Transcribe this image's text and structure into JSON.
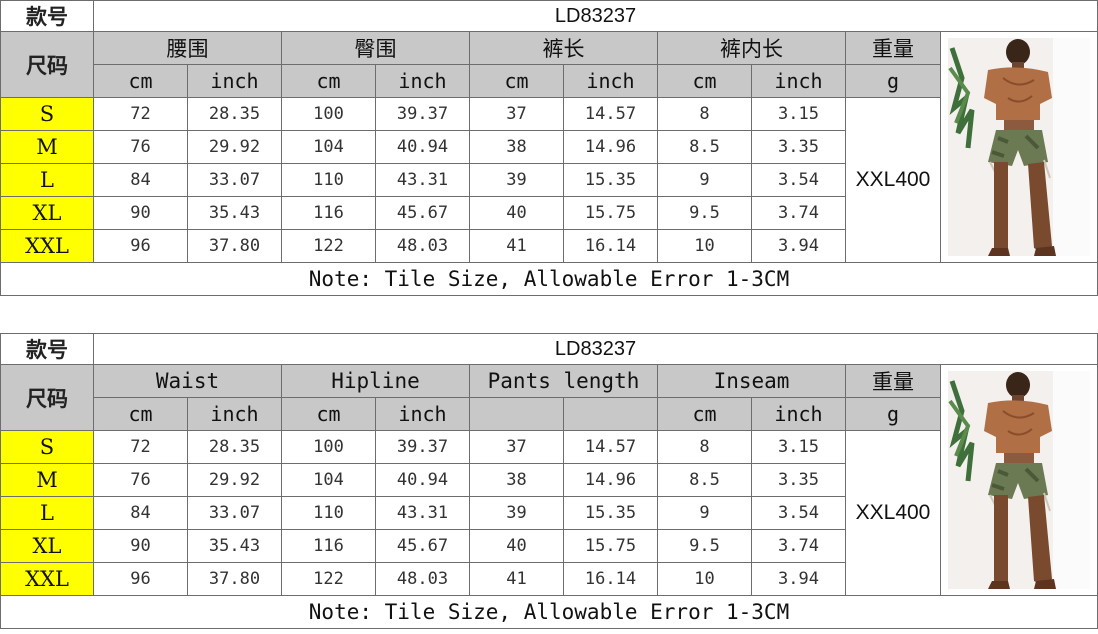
{
  "tables": [
    {
      "style_label": "款号",
      "style_code": "LD83237",
      "size_label": "尺码",
      "groups": [
        "腰围",
        "臀围",
        "裤长",
        "裤内长"
      ],
      "weight_label": "重量",
      "subheaders": [
        "cm",
        "inch",
        "cm",
        "inch",
        "cm",
        "inch",
        "cm",
        "inch"
      ],
      "weight_unit": "g",
      "rows": [
        {
          "size": "S",
          "values": [
            "72",
            "28.35",
            "100",
            "39.37",
            "37",
            "14.57",
            "8",
            "3.15"
          ]
        },
        {
          "size": "M",
          "values": [
            "76",
            "29.92",
            "104",
            "40.94",
            "38",
            "14.96",
            "8.5",
            "3.35"
          ]
        },
        {
          "size": "L",
          "values": [
            "84",
            "33.07",
            "110",
            "43.31",
            "39",
            "15.35",
            "9",
            "3.54"
          ]
        },
        {
          "size": "XL",
          "values": [
            "90",
            "35.43",
            "116",
            "45.67",
            "40",
            "15.75",
            "9.5",
            "3.74"
          ]
        },
        {
          "size": "XXL",
          "values": [
            "96",
            "37.80",
            "122",
            "48.03",
            "41",
            "16.14",
            "10",
            "3.94"
          ]
        }
      ],
      "weight_value": "XXL400",
      "note": "Note: Tile Size, Allowable Error 1-3CM"
    },
    {
      "style_label": "款号",
      "style_code": "LD83237",
      "size_label": "尺码",
      "groups": [
        "Waist",
        "Hipline",
        "Pants length",
        "Inseam"
      ],
      "weight_label": "重量",
      "subheaders": [
        "cm",
        "inch",
        "cm",
        "inch",
        "",
        "",
        "cm",
        "inch"
      ],
      "weight_unit": "g",
      "rows": [
        {
          "size": "S",
          "values": [
            "72",
            "28.35",
            "100",
            "39.37",
            "37",
            "14.57",
            "8",
            "3.15"
          ]
        },
        {
          "size": "M",
          "values": [
            "76",
            "29.92",
            "104",
            "40.94",
            "38",
            "14.96",
            "8.5",
            "3.35"
          ]
        },
        {
          "size": "L",
          "values": [
            "84",
            "33.07",
            "110",
            "43.31",
            "39",
            "15.35",
            "9",
            "3.54"
          ]
        },
        {
          "size": "XL",
          "values": [
            "90",
            "35.43",
            "116",
            "45.67",
            "40",
            "15.75",
            "9.5",
            "3.74"
          ]
        },
        {
          "size": "XXL",
          "values": [
            "96",
            "37.80",
            "122",
            "48.03",
            "41",
            "16.14",
            "10",
            "3.94"
          ]
        }
      ],
      "weight_value": "XXL400",
      "note": "Note: Tile Size, Allowable Error 1-3CM"
    }
  ],
  "colors": {
    "header_gray": "#c8c8c8",
    "size_yellow": "#ffff00",
    "border": "#6d6d6d"
  }
}
